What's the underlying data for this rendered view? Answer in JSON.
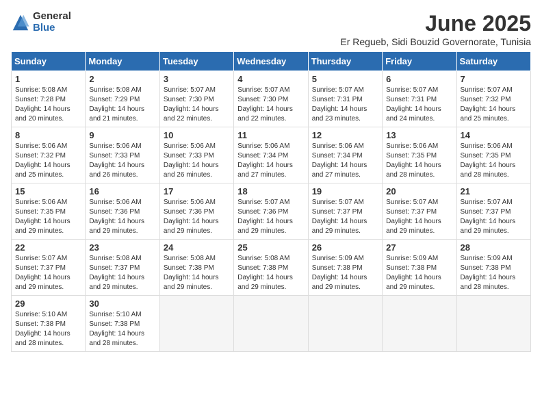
{
  "logo": {
    "general": "General",
    "blue": "Blue"
  },
  "title": "June 2025",
  "subtitle": "Er Regueb, Sidi Bouzid Governorate, Tunisia",
  "headers": [
    "Sunday",
    "Monday",
    "Tuesday",
    "Wednesday",
    "Thursday",
    "Friday",
    "Saturday"
  ],
  "weeks": [
    [
      {
        "day": "1",
        "sunrise": "5:08 AM",
        "sunset": "7:28 PM",
        "daylight": "14 hours and 20 minutes."
      },
      {
        "day": "2",
        "sunrise": "5:08 AM",
        "sunset": "7:29 PM",
        "daylight": "14 hours and 21 minutes."
      },
      {
        "day": "3",
        "sunrise": "5:07 AM",
        "sunset": "7:30 PM",
        "daylight": "14 hours and 22 minutes."
      },
      {
        "day": "4",
        "sunrise": "5:07 AM",
        "sunset": "7:30 PM",
        "daylight": "14 hours and 22 minutes."
      },
      {
        "day": "5",
        "sunrise": "5:07 AM",
        "sunset": "7:31 PM",
        "daylight": "14 hours and 23 minutes."
      },
      {
        "day": "6",
        "sunrise": "5:07 AM",
        "sunset": "7:31 PM",
        "daylight": "14 hours and 24 minutes."
      },
      {
        "day": "7",
        "sunrise": "5:07 AM",
        "sunset": "7:32 PM",
        "daylight": "14 hours and 25 minutes."
      }
    ],
    [
      {
        "day": "8",
        "sunrise": "5:06 AM",
        "sunset": "7:32 PM",
        "daylight": "14 hours and 25 minutes."
      },
      {
        "day": "9",
        "sunrise": "5:06 AM",
        "sunset": "7:33 PM",
        "daylight": "14 hours and 26 minutes."
      },
      {
        "day": "10",
        "sunrise": "5:06 AM",
        "sunset": "7:33 PM",
        "daylight": "14 hours and 26 minutes."
      },
      {
        "day": "11",
        "sunrise": "5:06 AM",
        "sunset": "7:34 PM",
        "daylight": "14 hours and 27 minutes."
      },
      {
        "day": "12",
        "sunrise": "5:06 AM",
        "sunset": "7:34 PM",
        "daylight": "14 hours and 27 minutes."
      },
      {
        "day": "13",
        "sunrise": "5:06 AM",
        "sunset": "7:35 PM",
        "daylight": "14 hours and 28 minutes."
      },
      {
        "day": "14",
        "sunrise": "5:06 AM",
        "sunset": "7:35 PM",
        "daylight": "14 hours and 28 minutes."
      }
    ],
    [
      {
        "day": "15",
        "sunrise": "5:06 AM",
        "sunset": "7:35 PM",
        "daylight": "14 hours and 29 minutes."
      },
      {
        "day": "16",
        "sunrise": "5:06 AM",
        "sunset": "7:36 PM",
        "daylight": "14 hours and 29 minutes."
      },
      {
        "day": "17",
        "sunrise": "5:06 AM",
        "sunset": "7:36 PM",
        "daylight": "14 hours and 29 minutes."
      },
      {
        "day": "18",
        "sunrise": "5:07 AM",
        "sunset": "7:36 PM",
        "daylight": "14 hours and 29 minutes."
      },
      {
        "day": "19",
        "sunrise": "5:07 AM",
        "sunset": "7:37 PM",
        "daylight": "14 hours and 29 minutes."
      },
      {
        "day": "20",
        "sunrise": "5:07 AM",
        "sunset": "7:37 PM",
        "daylight": "14 hours and 29 minutes."
      },
      {
        "day": "21",
        "sunrise": "5:07 AM",
        "sunset": "7:37 PM",
        "daylight": "14 hours and 29 minutes."
      }
    ],
    [
      {
        "day": "22",
        "sunrise": "5:07 AM",
        "sunset": "7:37 PM",
        "daylight": "14 hours and 29 minutes."
      },
      {
        "day": "23",
        "sunrise": "5:08 AM",
        "sunset": "7:37 PM",
        "daylight": "14 hours and 29 minutes."
      },
      {
        "day": "24",
        "sunrise": "5:08 AM",
        "sunset": "7:38 PM",
        "daylight": "14 hours and 29 minutes."
      },
      {
        "day": "25",
        "sunrise": "5:08 AM",
        "sunset": "7:38 PM",
        "daylight": "14 hours and 29 minutes."
      },
      {
        "day": "26",
        "sunrise": "5:09 AM",
        "sunset": "7:38 PM",
        "daylight": "14 hours and 29 minutes."
      },
      {
        "day": "27",
        "sunrise": "5:09 AM",
        "sunset": "7:38 PM",
        "daylight": "14 hours and 29 minutes."
      },
      {
        "day": "28",
        "sunrise": "5:09 AM",
        "sunset": "7:38 PM",
        "daylight": "14 hours and 28 minutes."
      }
    ],
    [
      {
        "day": "29",
        "sunrise": "5:10 AM",
        "sunset": "7:38 PM",
        "daylight": "14 hours and 28 minutes."
      },
      {
        "day": "30",
        "sunrise": "5:10 AM",
        "sunset": "7:38 PM",
        "daylight": "14 hours and 28 minutes."
      },
      null,
      null,
      null,
      null,
      null
    ]
  ]
}
